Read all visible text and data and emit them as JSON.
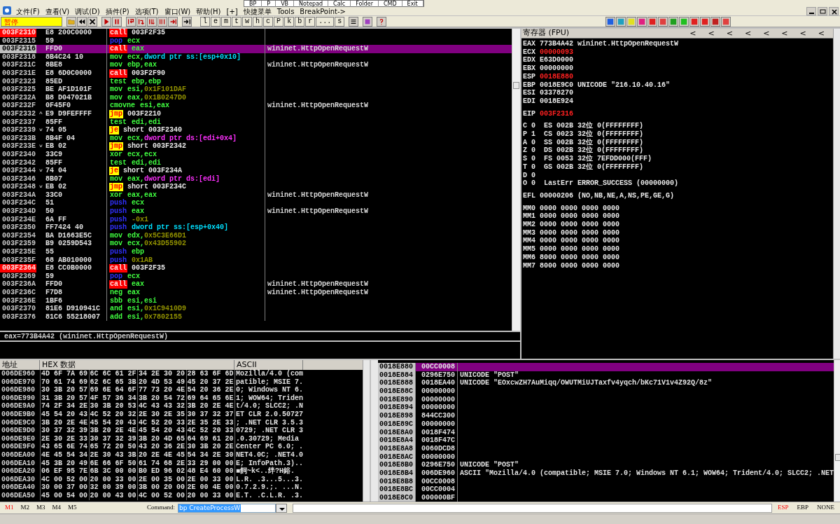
{
  "menu": [
    "文件(F)",
    "查看(V)",
    "调试(D)",
    "插件(P)",
    "选项(T)",
    "窗口(W)",
    "帮助(H)",
    "[+]",
    "快捷菜单",
    "Tools",
    "BreakPoint->"
  ],
  "quick_bar": [
    "BP",
    "P",
    "VB",
    "Notepad",
    "Calc",
    "Folder",
    "CMD",
    "Exit"
  ],
  "toolbar": {
    "status": "暂停",
    "window_buttons": [
      "l",
      "e",
      "m",
      "t",
      "w",
      "h",
      "c",
      "P",
      "k",
      "b",
      "r",
      "...",
      "s"
    ]
  },
  "disassembly": {
    "rows": [
      {
        "address": "003F2310",
        "hex": "E8 200C0000",
        "mnemonic": "call",
        "kind": "call",
        "operands": [
          {
            "text": "003F2F35",
            "kind": "addr"
          }
        ],
        "breakpoint": true,
        "selected": false
      },
      {
        "address": "003F2315",
        "hex": "59",
        "mnemonic": "pop",
        "kind": "stack",
        "operands": [
          {
            "text": "ecx",
            "kind": "reg"
          }
        ],
        "breakpoint": false,
        "selected": false
      },
      {
        "address": "003F2316",
        "hex": "FFD0",
        "mnemonic": "call",
        "kind": "call",
        "operands": [
          {
            "text": "eax",
            "kind": "reg"
          }
        ],
        "comment": "wininet.HttpOpenRequestW",
        "breakpoint": false,
        "selected": true
      },
      {
        "address": "003F2318",
        "hex": "8B4C24 10",
        "mnemonic": "mov",
        "kind": "plain",
        "operands": [
          {
            "text": "ecx,",
            "kind": "reg"
          },
          {
            "text": "dword ptr ss:[esp+0x10]",
            "kind": "mem_ss"
          }
        ],
        "breakpoint": false,
        "selected": false
      },
      {
        "address": "003F231C",
        "hex": "8BE8",
        "mnemonic": "mov",
        "kind": "plain",
        "operands": [
          {
            "text": "ebp,eax",
            "kind": "reg"
          }
        ],
        "comment": "wininet.HttpOpenRequestW",
        "breakpoint": false,
        "selected": false
      },
      {
        "address": "003F231E",
        "hex": "E8 6D0C0000",
        "mnemonic": "call",
        "kind": "call",
        "operands": [
          {
            "text": "003F2F90",
            "kind": "addr"
          }
        ],
        "breakpoint": false,
        "selected": false
      },
      {
        "address": "003F2323",
        "hex": "85ED",
        "mnemonic": "test",
        "kind": "plain",
        "operands": [
          {
            "text": "ebp,ebp",
            "kind": "reg"
          }
        ],
        "breakpoint": false,
        "selected": false
      },
      {
        "address": "003F2325",
        "hex": "BE AF1D101F",
        "mnemonic": "mov",
        "kind": "plain",
        "operands": [
          {
            "text": "esi,",
            "kind": "reg"
          },
          {
            "text": "0x1F101DAF",
            "kind": "const"
          }
        ],
        "breakpoint": false,
        "selected": false
      },
      {
        "address": "003F232A",
        "hex": "B8 D047021B",
        "mnemonic": "mov",
        "kind": "plain",
        "operands": [
          {
            "text": "eax,",
            "kind": "reg"
          },
          {
            "text": "0x1B0247D0",
            "kind": "const"
          }
        ],
        "breakpoint": false,
        "selected": false
      },
      {
        "address": "003F232F",
        "hex": "0F45F0",
        "mnemonic": "cmovne",
        "kind": "plain",
        "operands": [
          {
            "text": "esi,eax",
            "kind": "reg"
          }
        ],
        "comment": "wininet.HttpOpenRequestW",
        "breakpoint": false,
        "selected": false
      },
      {
        "address": "003F2332",
        "hex": "E9 D9FEFFFF",
        "jump_mark": "^",
        "mnemonic": "jmp",
        "kind": "jump",
        "operands": [
          {
            "text": "003F2210",
            "kind": "addr"
          }
        ],
        "breakpoint": false,
        "selected": false
      },
      {
        "address": "003F2337",
        "hex": "85FF",
        "mnemonic": "test",
        "kind": "plain",
        "operands": [
          {
            "text": "edi,edi",
            "kind": "reg"
          }
        ],
        "breakpoint": false,
        "selected": false
      },
      {
        "address": "003F2339",
        "hex": "74 05",
        "jump_mark": "˅",
        "mnemonic": "je",
        "kind": "jump",
        "operands": [
          {
            "text": "short 003F2340",
            "kind": "addr"
          }
        ],
        "breakpoint": false,
        "selected": false
      },
      {
        "address": "003F233B",
        "hex": "8B4F 04",
        "mnemonic": "mov",
        "kind": "plain",
        "operands": [
          {
            "text": "ecx,",
            "kind": "reg"
          },
          {
            "text": "dword ptr ds:[edi+0x4]",
            "kind": "mem_ds"
          }
        ],
        "breakpoint": false,
        "selected": false
      },
      {
        "address": "003F233E",
        "hex": "EB 02",
        "jump_mark": "˅",
        "mnemonic": "jmp",
        "kind": "jump",
        "operands": [
          {
            "text": "short 003F2342",
            "kind": "addr"
          }
        ],
        "breakpoint": false,
        "selected": false
      },
      {
        "address": "003F2340",
        "hex": "33C9",
        "mnemonic": "xor",
        "kind": "plain",
        "operands": [
          {
            "text": "ecx,ecx",
            "kind": "reg"
          }
        ],
        "breakpoint": false,
        "selected": false
      },
      {
        "address": "003F2342",
        "hex": "85FF",
        "mnemonic": "test",
        "kind": "plain",
        "operands": [
          {
            "text": "edi,edi",
            "kind": "reg"
          }
        ],
        "breakpoint": false,
        "selected": false
      },
      {
        "address": "003F2344",
        "hex": "74 04",
        "jump_mark": "˅",
        "mnemonic": "je",
        "kind": "jump",
        "operands": [
          {
            "text": "short 003F234A",
            "kind": "addr"
          }
        ],
        "breakpoint": false,
        "selected": false
      },
      {
        "address": "003F2346",
        "hex": "8B07",
        "mnemonic": "mov",
        "kind": "plain",
        "operands": [
          {
            "text": "eax,",
            "kind": "reg"
          },
          {
            "text": "dword ptr ds:[edi]",
            "kind": "mem_ds"
          }
        ],
        "breakpoint": false,
        "selected": false
      },
      {
        "address": "003F2348",
        "hex": "EB 02",
        "jump_mark": "˅",
        "mnemonic": "jmp",
        "kind": "jump",
        "operands": [
          {
            "text": "short 003F234C",
            "kind": "addr"
          }
        ],
        "breakpoint": false,
        "selected": false
      },
      {
        "address": "003F234A",
        "hex": "33C0",
        "mnemonic": "xor",
        "kind": "plain",
        "operands": [
          {
            "text": "eax,eax",
            "kind": "reg"
          }
        ],
        "comment": "wininet.HttpOpenRequestW",
        "breakpoint": false,
        "selected": false
      },
      {
        "address": "003F234C",
        "hex": "51",
        "mnemonic": "push",
        "kind": "stack",
        "operands": [
          {
            "text": "ecx",
            "kind": "reg"
          }
        ],
        "breakpoint": false,
        "selected": false
      },
      {
        "address": "003F234D",
        "hex": "50",
        "mnemonic": "push",
        "kind": "stack",
        "operands": [
          {
            "text": "eax",
            "kind": "reg"
          }
        ],
        "comment": "wininet.HttpOpenRequestW",
        "breakpoint": false,
        "selected": false
      },
      {
        "address": "003F234E",
        "hex": "6A FF",
        "mnemonic": "push",
        "kind": "stack",
        "operands": [
          {
            "text": "-0x1",
            "kind": "const"
          }
        ],
        "breakpoint": false,
        "selected": false
      },
      {
        "address": "003F2350",
        "hex": "FF7424 40",
        "mnemonic": "push",
        "kind": "stack",
        "operands": [
          {
            "text": "dword ptr ss:[esp+0x40]",
            "kind": "mem_ss"
          }
        ],
        "breakpoint": false,
        "selected": false
      },
      {
        "address": "003F2354",
        "hex": "BA D1663E5C",
        "mnemonic": "mov",
        "kind": "plain",
        "operands": [
          {
            "text": "edx,",
            "kind": "reg"
          },
          {
            "text": "0x5C3E66D1",
            "kind": "const"
          }
        ],
        "breakpoint": false,
        "selected": false
      },
      {
        "address": "003F2359",
        "hex": "B9 0259D543",
        "mnemonic": "mov",
        "kind": "plain",
        "operands": [
          {
            "text": "ecx,",
            "kind": "reg"
          },
          {
            "text": "0x43D55902",
            "kind": "const"
          }
        ],
        "breakpoint": false,
        "selected": false
      },
      {
        "address": "003F235E",
        "hex": "55",
        "mnemonic": "push",
        "kind": "stack",
        "operands": [
          {
            "text": "ebp",
            "kind": "reg"
          }
        ],
        "breakpoint": false,
        "selected": false
      },
      {
        "address": "003F235F",
        "hex": "68 AB010000",
        "mnemonic": "push",
        "kind": "stack",
        "operands": [
          {
            "text": "0x1AB",
            "kind": "const"
          }
        ],
        "breakpoint": false,
        "selected": false
      },
      {
        "address": "003F2364",
        "hex": "E8 CC0B0000",
        "mnemonic": "call",
        "kind": "call",
        "operands": [
          {
            "text": "003F2F35",
            "kind": "addr"
          }
        ],
        "breakpoint": true,
        "selected": false
      },
      {
        "address": "003F2369",
        "hex": "59",
        "mnemonic": "pop",
        "kind": "stack",
        "operands": [
          {
            "text": "ecx",
            "kind": "reg"
          }
        ],
        "breakpoint": false,
        "selected": false
      },
      {
        "address": "003F236A",
        "hex": "FFD0",
        "mnemonic": "call",
        "kind": "call",
        "operands": [
          {
            "text": "eax",
            "kind": "reg"
          }
        ],
        "comment": "wininet.HttpOpenRequestW",
        "breakpoint": false,
        "selected": false
      },
      {
        "address": "003F236C",
        "hex": "F7D8",
        "mnemonic": "neg",
        "kind": "plain",
        "operands": [
          {
            "text": "eax",
            "kind": "reg"
          }
        ],
        "comment": "wininet.HttpOpenRequestW",
        "breakpoint": false,
        "selected": false
      },
      {
        "address": "003F236E",
        "hex": "1BF6",
        "mnemonic": "sbb",
        "kind": "plain",
        "operands": [
          {
            "text": "esi,esi",
            "kind": "reg"
          }
        ],
        "breakpoint": false,
        "selected": false
      },
      {
        "address": "003F2370",
        "hex": "81E6 D910941C",
        "mnemonic": "and",
        "kind": "plain",
        "operands": [
          {
            "text": "esi,",
            "kind": "reg"
          },
          {
            "text": "0x1C9410D9",
            "kind": "const"
          }
        ],
        "breakpoint": false,
        "selected": false
      },
      {
        "address": "003F2376",
        "hex": "81C6 55218007",
        "mnemonic": "add",
        "kind": "plain",
        "operands": [
          {
            "text": "esi,",
            "kind": "reg"
          },
          {
            "text": "0x7802155",
            "kind": "const"
          }
        ],
        "breakpoint": false,
        "selected": false
      }
    ],
    "info": "eax=773B4A42 (wininet.HttpOpenRequestW)"
  },
  "registers": {
    "title": "寄存器 (FPU)",
    "nav_buttons": [
      "<",
      "<",
      "<",
      "<",
      "<",
      "<",
      "<",
      "<"
    ],
    "general": [
      {
        "name": "EAX",
        "value": "773B4A42",
        "note": "wininet.HttpOpenRequestW",
        "changed": false
      },
      {
        "name": "ECX",
        "value": "00000093",
        "changed": true
      },
      {
        "name": "EDX",
        "value": "E63D0000",
        "changed": false
      },
      {
        "name": "EBX",
        "value": "00000000",
        "changed": false
      },
      {
        "name": "ESP",
        "value": "0018E880",
        "changed": true
      },
      {
        "name": "EBP",
        "value": "0018E9C0",
        "note": "UNICODE \"216.10.40.16\"",
        "changed": false
      },
      {
        "name": "ESI",
        "value": "03378270",
        "changed": false
      },
      {
        "name": "EDI",
        "value": "0018E924",
        "changed": false
      }
    ],
    "eip": {
      "name": "EIP",
      "value": "003F2316",
      "changed": true
    },
    "flags": [
      {
        "flag": "C",
        "value": "0",
        "detail": "ES 002B 32位 0(FFFFFFFF)"
      },
      {
        "flag": "P",
        "value": "1",
        "detail": "CS 0023 32位 0(FFFFFFFF)"
      },
      {
        "flag": "A",
        "value": "0",
        "detail": "SS 002B 32位 0(FFFFFFFF)"
      },
      {
        "flag": "Z",
        "value": "0",
        "detail": "DS 002B 32位 0(FFFFFFFF)"
      },
      {
        "flag": "S",
        "value": "0",
        "detail": "FS 0053 32位 7EFDD000(FFF)"
      },
      {
        "flag": "T",
        "value": "0",
        "detail": "GS 002B 32位 0(FFFFFFFF)"
      },
      {
        "flag": "D",
        "value": "0"
      },
      {
        "flag": "O",
        "value": "0",
        "detail": "LastErr ERROR_SUCCESS (00000000)"
      }
    ],
    "efl": {
      "name": "EFL",
      "value": "00000206 (NO,NB,NE,A,NS,PE,GE,G)"
    },
    "mmx": [
      {
        "name": "MM0",
        "value": "0000 0000 0000 0000"
      },
      {
        "name": "MM1",
        "value": "0000 0000 0000 0000"
      },
      {
        "name": "MM2",
        "value": "0000 0000 0000 0000"
      },
      {
        "name": "MM3",
        "value": "0000 0000 0000 0000"
      },
      {
        "name": "MM4",
        "value": "0000 0000 0000 0000"
      },
      {
        "name": "MM5",
        "value": "0000 0000 0000 0000"
      },
      {
        "name": "MM6",
        "value": "8000 0000 0000 0000"
      },
      {
        "name": "MM7",
        "value": "8000 0000 0000 0000"
      }
    ]
  },
  "dump": {
    "columns": [
      "地址",
      "HEX 数据",
      "ASCII"
    ],
    "rows": [
      {
        "address": "006DE960",
        "bytes": [
          "4D 6F 7A 69",
          "6C 6C 61 2F",
          "34 2E 30 20",
          "28 63 6F 6D"
        ],
        "ascii": "Mozilla/4.0 (com"
      },
      {
        "address": "006DE970",
        "bytes": [
          "70 61 74 69",
          "62 6C 65 3B",
          "20 4D 53 49",
          "45 20 37 2E"
        ],
        "ascii": "patible; MSIE 7."
      },
      {
        "address": "006DE980",
        "bytes": [
          "30 3B 20 57",
          "69 6E 64 6F",
          "77 73 20 4E",
          "54 20 36 2E"
        ],
        "ascii": "0; Windows NT 6."
      },
      {
        "address": "006DE990",
        "bytes": [
          "31 3B 20 57",
          "4F 57 36 34",
          "3B 20 54 72",
          "69 64 65 6E"
        ],
        "ascii": "1; WOW64; Triden"
      },
      {
        "address": "006DE9A0",
        "bytes": [
          "74 2F 34 2E",
          "30 3B 20 53",
          "4C 43 43 32",
          "3B 20 2E 4E"
        ],
        "ascii": "t/4.0; SLCC2; .N"
      },
      {
        "address": "006DE9B0",
        "bytes": [
          "45 54 20 43",
          "4C 52 20 32",
          "2E 30 2E 35",
          "30 37 32 37"
        ],
        "ascii": "ET CLR 2.0.50727"
      },
      {
        "address": "006DE9C0",
        "bytes": [
          "3B 20 2E 4E",
          "45 54 20 43",
          "4C 52 20 33",
          "2E 35 2E 33"
        ],
        "ascii": "; .NET CLR 3.5.3"
      },
      {
        "address": "006DE9D0",
        "bytes": [
          "30 37 32 39",
          "3B 20 2E 4E",
          "45 54 20 43",
          "4C 52 20 33"
        ],
        "ascii": "0729; .NET CLR 3"
      },
      {
        "address": "006DE9E0",
        "bytes": [
          "2E 30 2E 33",
          "30 37 32 39",
          "3B 20 4D 65",
          "64 69 61 20"
        ],
        "ascii": ".0.30729; Media"
      },
      {
        "address": "006DE9F0",
        "bytes": [
          "43 65 6E 74",
          "65 72 20 50",
          "43 20 36 2E",
          "30 3B 20 2E"
        ],
        "ascii": "Center PC 6.0; ."
      },
      {
        "address": "006DEA00",
        "bytes": [
          "4E 45 54 34",
          "2E 30 43 3B",
          "20 2E 4E 45",
          "54 34 2E 30"
        ],
        "ascii": "NET4.0C; .NET4.0"
      },
      {
        "address": "006DEA10",
        "bytes": [
          "45 3B 20 49",
          "6E 66 6F 50",
          "61 74 68 2E",
          "33 29 00 00"
        ],
        "ascii": "E; InfoPath.3).."
      },
      {
        "address": "006DEA20",
        "bytes": [
          "06 EF 95 7E",
          "6B 3C 00 00",
          "B0 ED 96 02",
          "48 E4 60 00"
        ],
        "ascii": "■飼~k<..绊?H鋊."
      },
      {
        "address": "006DEA30",
        "bytes": [
          "4C 00 52 00",
          "20 00 33 00",
          "2E 00 35 00",
          "2E 00 33 00"
        ],
        "ascii": "L.R. .3...5...3."
      },
      {
        "address": "006DEA40",
        "bytes": [
          "30 00 37 00",
          "32 00 39 00",
          "3B 00 20 00",
          "2E 00 4E 00"
        ],
        "ascii": "0.7.2.9.;. ...N."
      },
      {
        "address": "006DEA50",
        "bytes": [
          "45 00 54 00",
          "20 00 43 00",
          "4C 00 52 00",
          "20 00 33 00"
        ],
        "ascii": "E.T. .C.L.R. .3."
      }
    ]
  },
  "stack": {
    "rows": [
      {
        "address": "0018E880",
        "value": "00CC0008",
        "selected": true
      },
      {
        "address": "0018E884",
        "value": "0296E750",
        "comment": "UNICODE \"POST\"",
        "selected": false
      },
      {
        "address": "0018E888",
        "value": "0018EA40",
        "comment": "UNICODE \"EOxcwZH7AuMiqq/OWUTMiUJTaxfv4yqch/bKc71V1v4Z92Q/8z\"",
        "selected": false
      },
      {
        "address": "0018E88C",
        "value": "00000000",
        "selected": false
      },
      {
        "address": "0018E890",
        "value": "00000000",
        "selected": false
      },
      {
        "address": "0018E894",
        "value": "00000000",
        "selected": false
      },
      {
        "address": "0018E898",
        "value": "844CC300",
        "selected": false
      },
      {
        "address": "0018E89C",
        "value": "00000000",
        "selected": false
      },
      {
        "address": "0018E8A0",
        "value": "0018F474",
        "selected": false
      },
      {
        "address": "0018E8A4",
        "value": "0018F47C",
        "selected": false
      },
      {
        "address": "0018E8A8",
        "value": "0060DCD8",
        "selected": false
      },
      {
        "address": "0018E8AC",
        "value": "00000000",
        "selected": false
      },
      {
        "address": "0018E8B0",
        "value": "0296E750",
        "comment": "UNICODE \"POST\"",
        "selected": false
      },
      {
        "address": "0018E8B4",
        "value": "006DE960",
        "comment": "ASCII \"Mozilla/4.0 (compatible; MSIE 7.0; Windows NT 6.1; WOW64; Trident/4.0; SLCC2; .NET",
        "selected": false
      },
      {
        "address": "0018E8B8",
        "value": "00CC0008",
        "selected": false
      },
      {
        "address": "0018E8BC",
        "value": "00CC0004",
        "selected": false
      },
      {
        "address": "0018E8C0",
        "value": "000000BF",
        "selected": false
      }
    ]
  },
  "command_bar": {
    "dump_tabs": [
      {
        "label": "M1",
        "selected": true
      },
      {
        "label": "M2",
        "selected": false
      },
      {
        "label": "M3",
        "selected": false
      },
      {
        "label": "M4",
        "selected": false
      },
      {
        "label": "M5",
        "selected": false
      }
    ],
    "label": "Command:",
    "value": "bp CreateProcessW",
    "stack_modes": [
      {
        "label": "ESP",
        "selected": true
      },
      {
        "label": "EBP",
        "selected": false
      },
      {
        "label": "NONE",
        "selected": false
      }
    ]
  }
}
